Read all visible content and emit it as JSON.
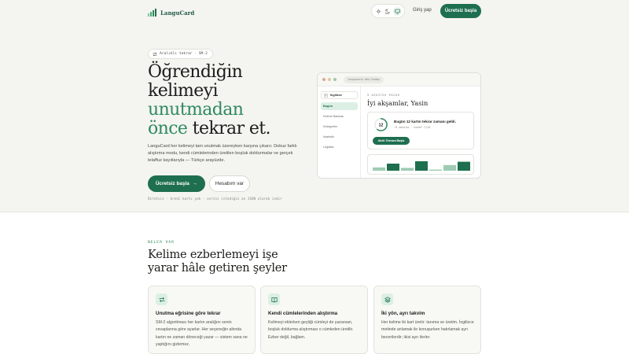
{
  "nav": {
    "brand": "LanguCard",
    "theme_options": [
      "sun-icon",
      "moon-icon",
      "monitor-icon"
    ],
    "login": "Giriş yap",
    "cta": "Ücretsiz başla"
  },
  "hero": {
    "pill": "Aralıklı tekrar · SM-2",
    "title_lines": [
      "Öğrendiğin",
      "kelimeyi",
      "unutmadan",
      "önce"
    ],
    "title_tail": " tekrar et.",
    "lead": "LanguCard her kelimeyi tam unutmak üzereyken karşına çıkarır. Dokuz farklı alıştırma modu, kendi cümlelerinden üretilen boşluk doldurmalar ve gerçek telaffuz kayıtlarıyla — Türkçe arayüzde.",
    "primary_button": "Ücretsiz başla",
    "primary_button_arrow": "→",
    "secondary_button": "Hesabım var",
    "note": "Ücretsiz · kredi kartı yok · verini istediğin an JSON olarak indir"
  },
  "mockup": {
    "url": "langucard.dev/today",
    "deck_icon": "E",
    "deck_name": "İngilizce",
    "menu": [
      "Bugün",
      "Kelime Bankası",
      "Kategoriler",
      "İstatistik",
      "Lüğatlar"
    ],
    "active_menu_index": 0,
    "date": "9 AĞUSTOS PAZAR",
    "greeting": "İyi akşamlar, Yasin",
    "due_count": "12",
    "due_progress": 0.6,
    "card_title": "Bugün 12 kartın tekrar zamanı geldi.",
    "card_sub": "~8 dakika · hedef 7/20",
    "card_button": "Akıllı Tekrara Başla",
    "chart_levels": [
      0.35,
      0.75,
      0.3,
      1.0,
      0.12,
      0.6,
      0.95
    ],
    "chart_tones": [
      "light",
      "dark",
      "light",
      "dark",
      "light",
      "light",
      "dark"
    ]
  },
  "features": {
    "eyebrow": "NELER VAR",
    "title_lines": [
      "Kelime ezberlemeyi işe",
      "yarar hâle getiren şeyler"
    ],
    "items": [
      {
        "icon": "repeat-icon",
        "title": "Unutma eğrisine göre tekrar",
        "text": "SM-2 algoritması her kartın aralığını senin cevaplarına göre ayarlar. Her seçeneğin altında kartın ne zaman döneceği yazar — sistem sana ne yaptığını gizlemez."
      },
      {
        "icon": "book-icon",
        "title": "Kendi cümlelerinden alıştırma",
        "text": "Kelimeyi eklerken geçtiği cümleyi de yazarsan, boşluk doldurma alıştırması o cümleden üretilir. Ezber değil, bağlam."
      },
      {
        "icon": "layers-icon",
        "title": "İki yön, ayrı takvim",
        "text": "Her kelime iki kart üretir: tanıma ve üretim. İngilizce metinde anlamak ile konuşurken hatırlamak ayrı becerilerdir; ikisi ayrı ilerler."
      }
    ]
  },
  "colors": {
    "brand": "#1e6f4f",
    "accent": "#2f8a5f",
    "hero_bg": "#f4f4f0"
  }
}
